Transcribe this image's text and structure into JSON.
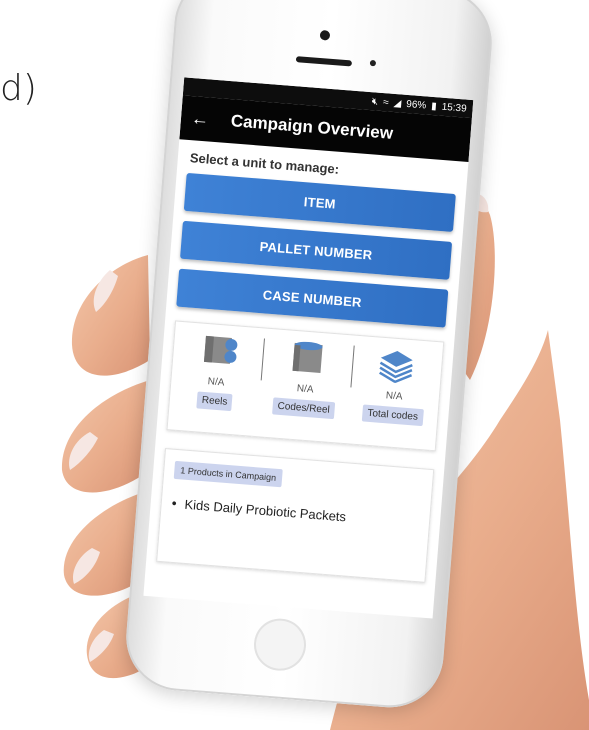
{
  "panel_label": "d)",
  "status_bar": {
    "battery": "96%",
    "time": "15:39"
  },
  "app_bar": {
    "title": "Campaign Overview",
    "back_icon": "arrow-left-icon"
  },
  "prompt": "Select a unit to manage:",
  "unit_buttons": [
    {
      "label": "ITEM"
    },
    {
      "label": "PALLET NUMBER"
    },
    {
      "label": "CASE NUMBER"
    }
  ],
  "stats": [
    {
      "icon": "reels-icon",
      "value": "N/A",
      "label": "Reels"
    },
    {
      "icon": "codes-per-reel-icon",
      "value": "N/A",
      "label": "Codes/Reel"
    },
    {
      "icon": "layers-icon",
      "value": "N/A",
      "label": "Total codes"
    }
  ],
  "products": {
    "badge": "1 Products in Campaign",
    "items": [
      "Kids Daily Probiotic Packets"
    ]
  },
  "colors": {
    "button_blue": "#3479cf",
    "badge_bg": "#ccd4ee",
    "app_bar_bg": "#050505"
  }
}
